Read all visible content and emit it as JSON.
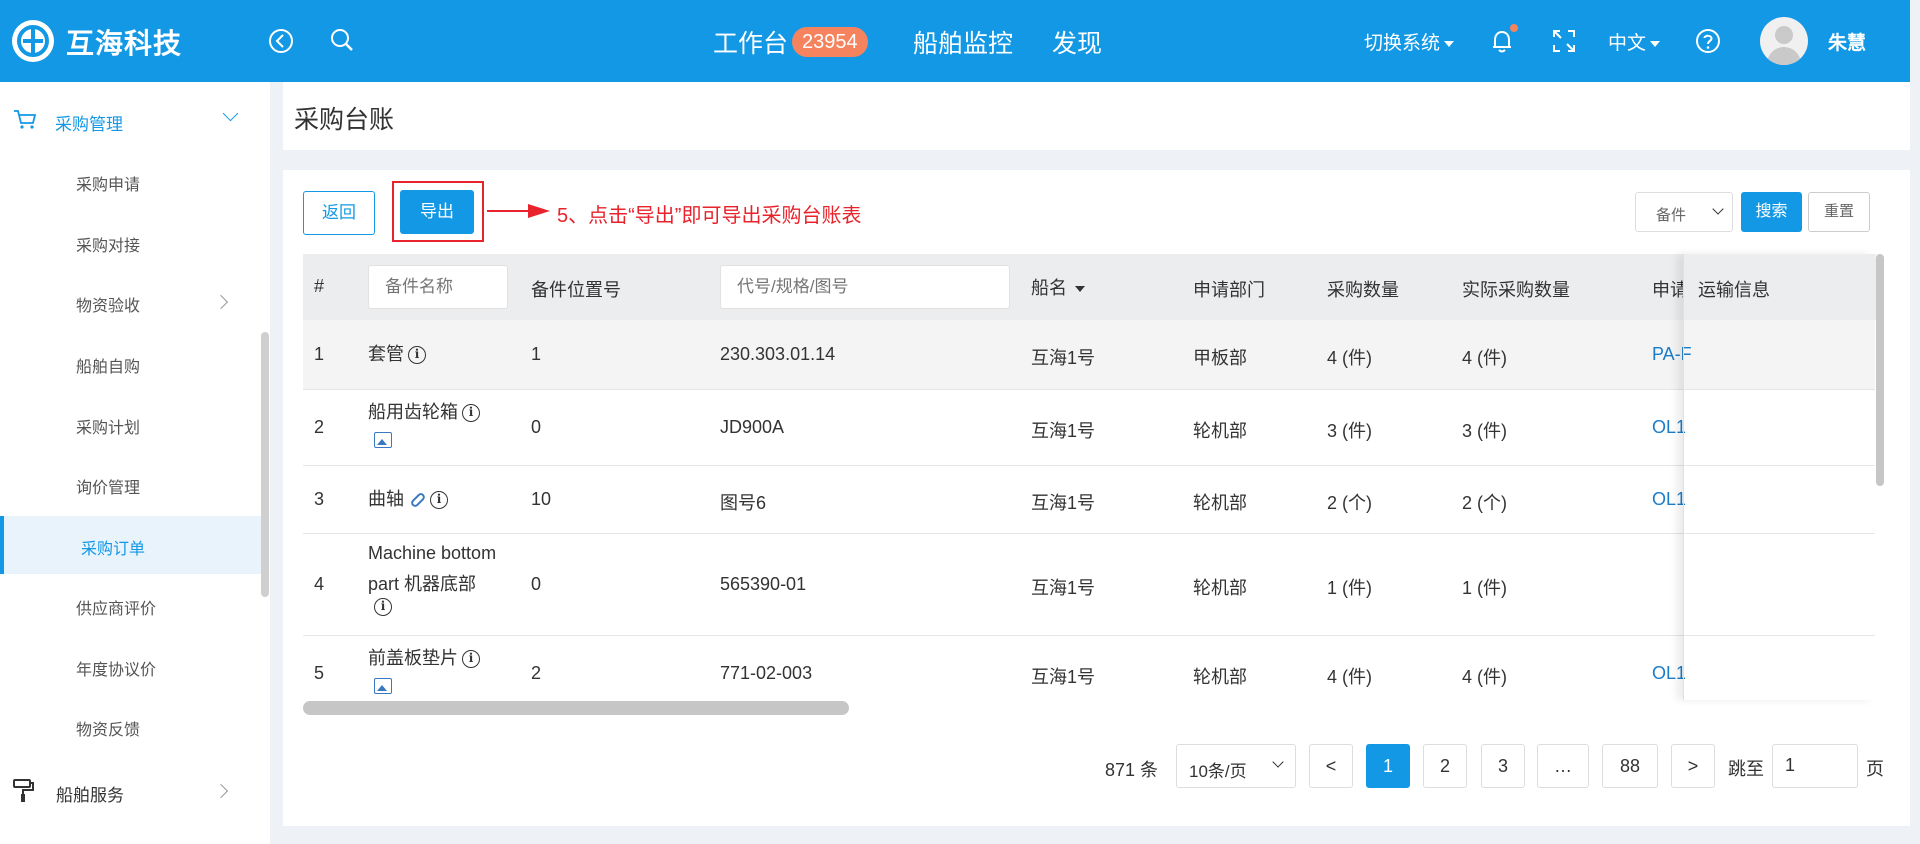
{
  "header": {
    "brand": "互海科技",
    "nav": {
      "workbench": "工作台",
      "workbench_badge": "23954",
      "ship_monitor": "船舶监控",
      "discover": "发现"
    },
    "switch_system": "切换系统",
    "language": "中文",
    "username": "朱慧"
  },
  "sidebar": {
    "group": "采购管理",
    "items": [
      {
        "label": "采购申请"
      },
      {
        "label": "采购对接"
      },
      {
        "label": "物资验收"
      },
      {
        "label": "船舶自购"
      },
      {
        "label": "采购计划"
      },
      {
        "label": "询价管理"
      },
      {
        "label": "采购订单"
      },
      {
        "label": "供应商评价"
      },
      {
        "label": "年度协议价"
      },
      {
        "label": "物资反馈"
      }
    ],
    "footer_group": "船舶服务"
  },
  "page": {
    "title": "采购台账"
  },
  "toolbar": {
    "back": "返回",
    "export": "导出",
    "annotation": "5、点击“导出”即可导出采购台账表",
    "filter_select": "备件",
    "search": "搜索",
    "reset": "重置"
  },
  "table": {
    "headers": {
      "index": "#",
      "name_placeholder": "备件名称",
      "position": "备件位置号",
      "code_placeholder": "代号/规格/图号",
      "ship": "船名",
      "dept": "申请部门",
      "qty": "采购数量",
      "actual_qty": "实际采购数量",
      "apply": "申请",
      "transport": "运输信息"
    },
    "rows": [
      {
        "idx": "1",
        "name": "套管",
        "pos": "1",
        "code": "230.303.01.14",
        "ship": "互海1号",
        "dept": "甲板部",
        "qty": "4 (件)",
        "actual": "4 (件)",
        "apply": "PA-F"
      },
      {
        "idx": "2",
        "name": "船用齿轮箱",
        "pos": "0",
        "code": "JD900A",
        "ship": "互海1号",
        "dept": "轮机部",
        "qty": "3 (件)",
        "actual": "3 (件)",
        "apply": "OL1"
      },
      {
        "idx": "3",
        "name": "曲轴",
        "pos": "10",
        "code": "图号6",
        "ship": "互海1号",
        "dept": "轮机部",
        "qty": "2 (个)",
        "actual": "2 (个)",
        "apply": "OL1"
      },
      {
        "idx": "4",
        "name_line1": "Machine bottom",
        "name_line2": "part 机器底部",
        "pos": "0",
        "code": "565390-01",
        "ship": "互海1号",
        "dept": "轮机部",
        "qty": "1 (件)",
        "actual": "1 (件)",
        "apply": ""
      },
      {
        "idx": "5",
        "name": "前盖板垫片",
        "pos": "2",
        "code": "771-02-003",
        "ship": "互海1号",
        "dept": "轮机部",
        "qty": "4 (件)",
        "actual": "4 (件)",
        "apply": "OL1"
      }
    ]
  },
  "pagination": {
    "total": "871 条",
    "page_size": "10条/页",
    "prev": "<",
    "pages": [
      "1",
      "2",
      "3",
      "…",
      "88"
    ],
    "next": ">",
    "jump_label": "跳至",
    "jump_value": "1",
    "page_unit": "页"
  },
  "colors": {
    "primary": "#1398e6",
    "badge": "#f5845e",
    "annotation": "#e8232b"
  }
}
